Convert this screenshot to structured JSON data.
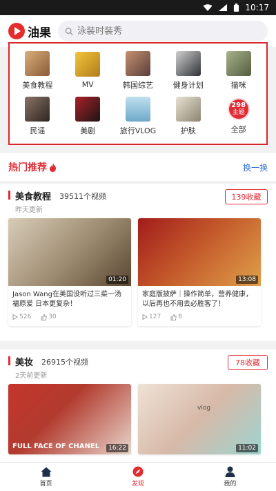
{
  "status": {
    "time": "10:17"
  },
  "header": {
    "logo_text": "油果",
    "search_placeholder": "泳装时装秀"
  },
  "categories": [
    {
      "label": "美食教程",
      "color": "#b5835a"
    },
    {
      "label": "MV",
      "color": "#d9a62a"
    },
    {
      "label": "韩国综艺",
      "color": "#8a5a48"
    },
    {
      "label": "健身计划",
      "color": "#55575c"
    },
    {
      "label": "猫咪",
      "color": "#7d8a68"
    },
    {
      "label": "民谣",
      "color": "#5a4a42"
    },
    {
      "label": "美剧",
      "color": "#3b2c2a"
    },
    {
      "label": "旅行VLOG",
      "color": "#8fc0d8"
    },
    {
      "label": "护肤",
      "color": "#c9c2b3"
    },
    {
      "label": "全部",
      "count": "298",
      "unit": "主题"
    }
  ],
  "hot": {
    "title": "热门推荐",
    "refresh": "换一换"
  },
  "channels": [
    {
      "title": "美食教程",
      "count": "39511个视频",
      "updated": "昨天更新",
      "fav": "139收藏",
      "videos": [
        {
          "title": "Jason Wang在美国没听过三菜一汤 福原爱 日本更复杂！",
          "duration": "01:20",
          "views": "526",
          "likes": "30",
          "color": "#9c8a6f"
        },
        {
          "title": "家庭版披萨｜操作简单，营养健康，以后再也不用去必胜客了！",
          "duration": "13:08",
          "views": "127",
          "likes": "8",
          "color": "#c2572a"
        }
      ]
    },
    {
      "title": "美妆",
      "count": "26915个视频",
      "updated": "2天前更新",
      "fav": "78收藏",
      "videos": [
        {
          "title": "",
          "duration": "16:22",
          "color": "#b23a2e",
          "overlay": "FULL FACE OF CHANEL"
        },
        {
          "title": "",
          "duration": "11:02",
          "color": "#d7b9a8",
          "overlay": "vlog"
        }
      ]
    }
  ],
  "tabs": [
    {
      "label": "首页"
    },
    {
      "label": "发现"
    },
    {
      "label": "我的"
    }
  ]
}
